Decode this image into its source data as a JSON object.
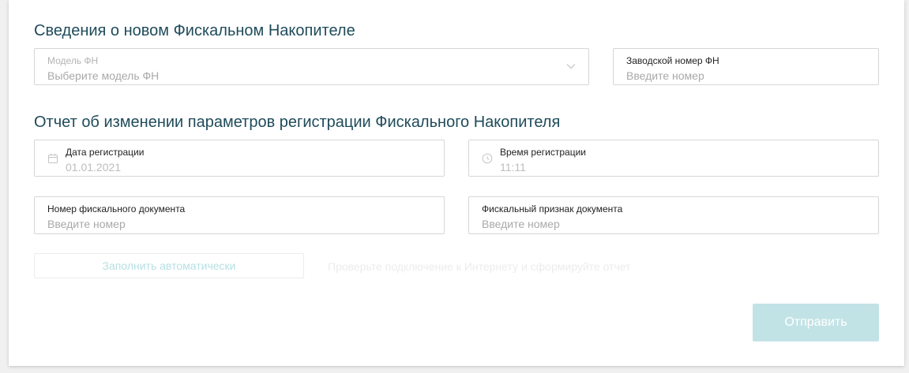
{
  "section_new_fn": {
    "title": "Сведения о новом Фискальном Накопителе",
    "model": {
      "label": "Модель ФН",
      "placeholder": "Выберите модель ФН"
    },
    "serial": {
      "label": "Заводской номер ФН",
      "placeholder": "Введите номер"
    }
  },
  "section_report": {
    "title": "Отчет об изменении параметров регистрации Фискального Накопителя",
    "reg_date": {
      "label": "Дата регистрации",
      "value": "01.01.2021"
    },
    "reg_time": {
      "label": "Время регистрации",
      "value": "11:11"
    },
    "doc_number": {
      "label": "Номер фискального документа",
      "placeholder": "Введите номер"
    },
    "doc_sign": {
      "label": "Фискальный признак документа",
      "placeholder": "Введите номер"
    }
  },
  "actions": {
    "autofill_label": "Заполнить автоматически",
    "hint": "Проверьте подключение к Интернету и сформируйте отчет",
    "submit_label": "Отправить"
  },
  "colors": {
    "title": "#1f4b5a",
    "accent_disabled": "#c2e3e6",
    "border": "#d6d6d6"
  }
}
